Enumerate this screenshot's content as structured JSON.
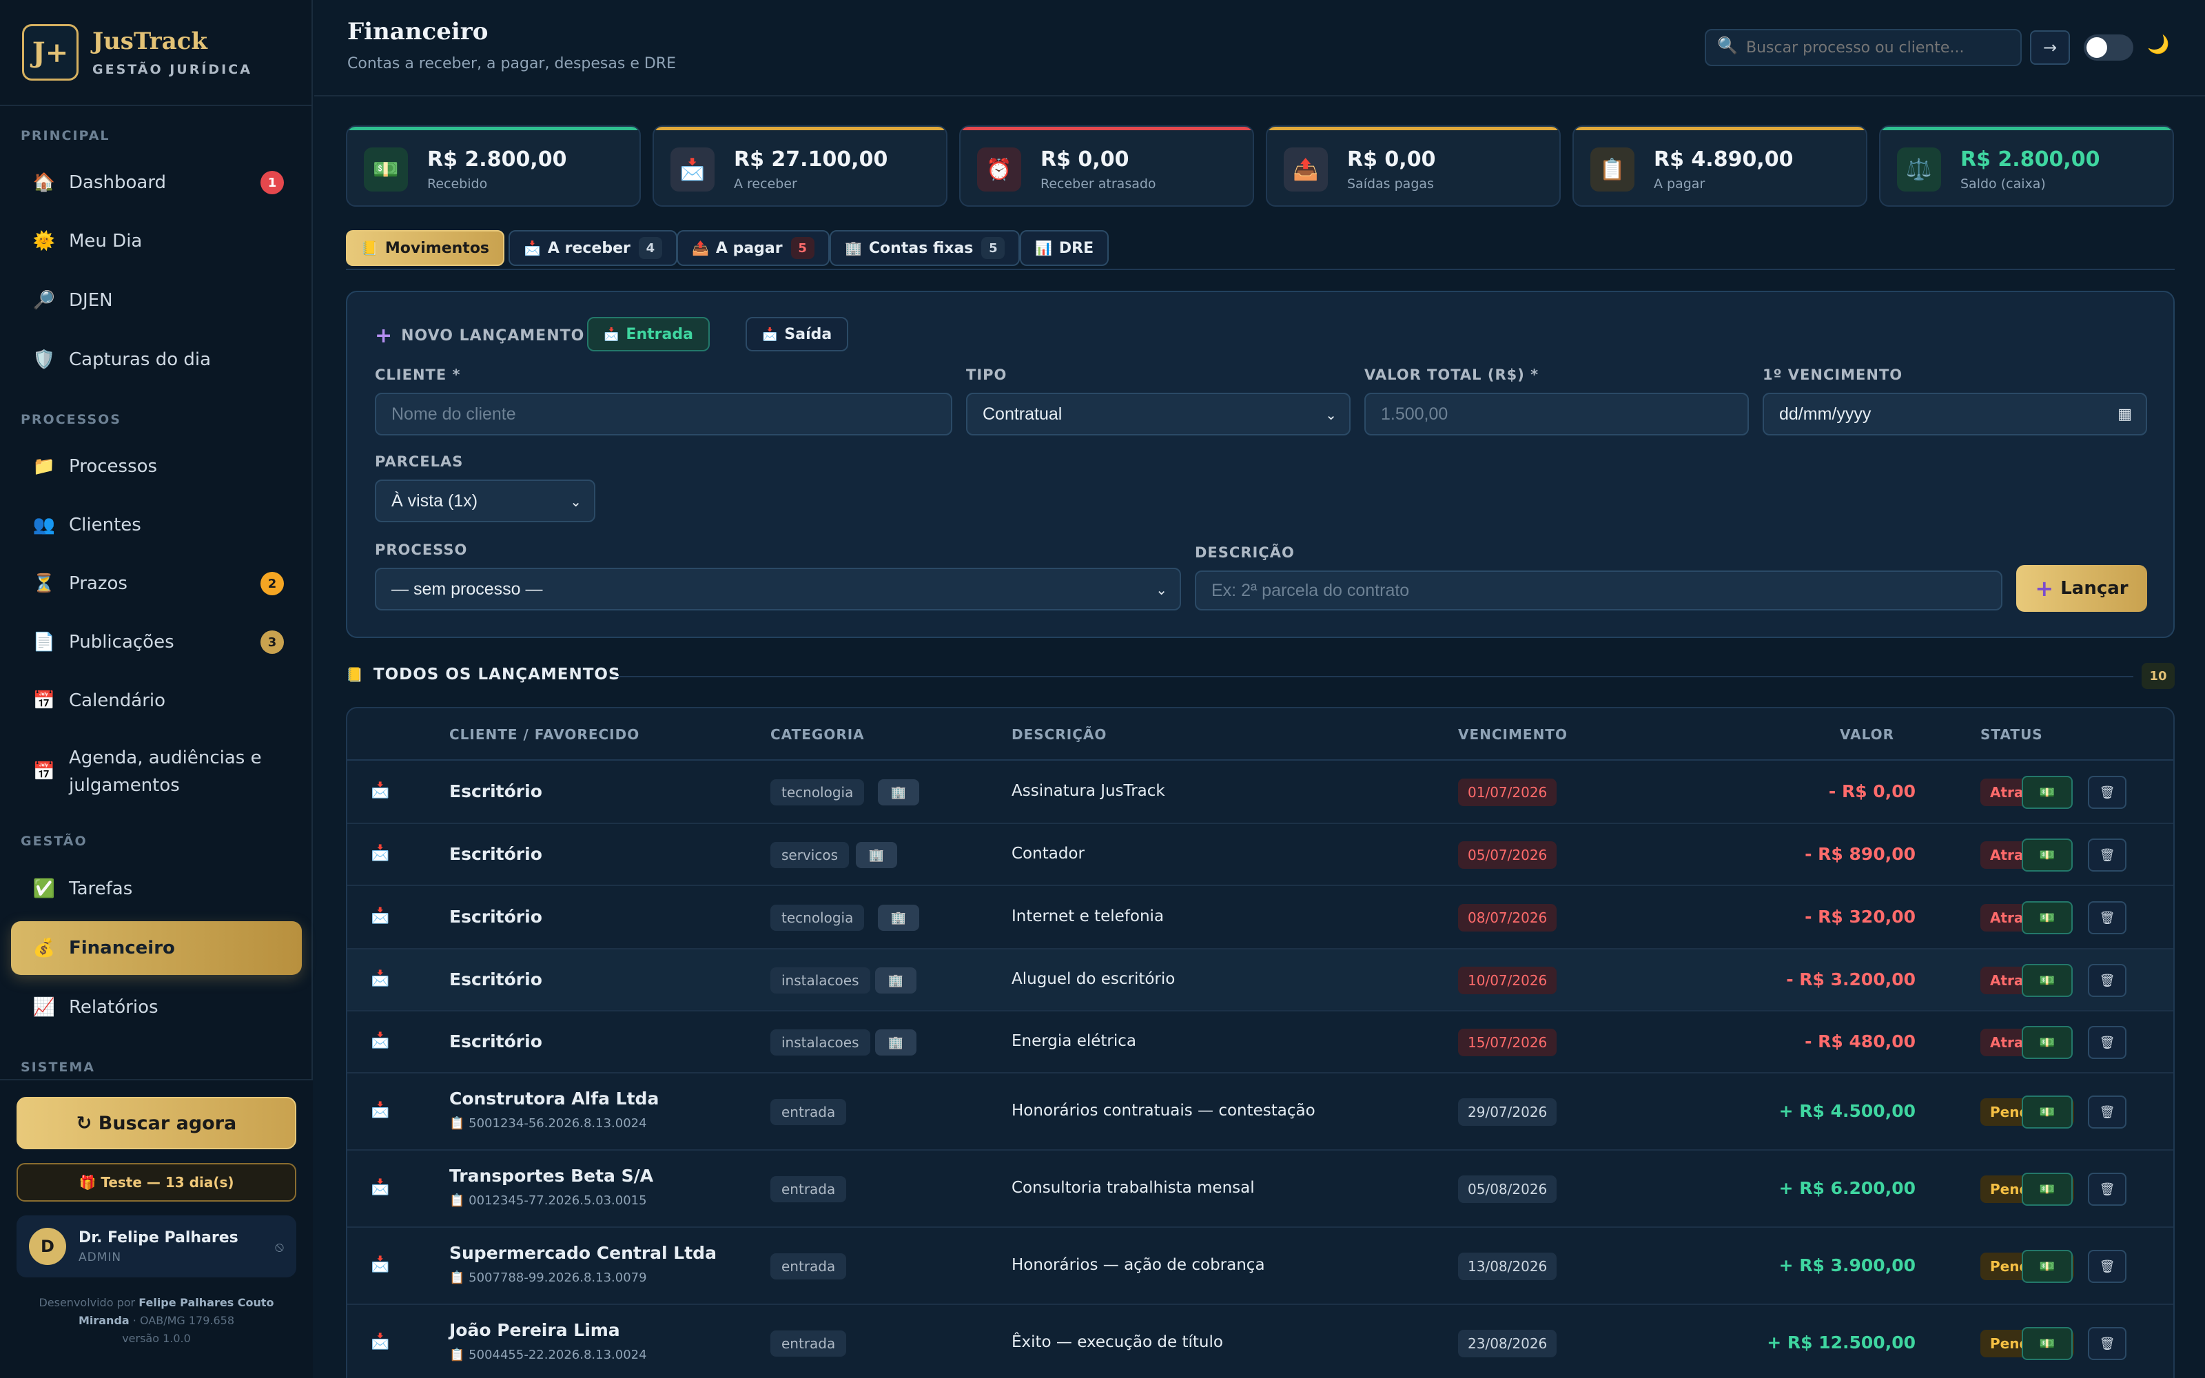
{
  "brand": {
    "logo": "J+",
    "name": "JusTrack",
    "subtitle": "GESTÃO JURÍDICA"
  },
  "sidebar": {
    "sections": {
      "principal": "PRINCIPAL",
      "processos": "PROCESSOS",
      "gestao": "GESTÃO",
      "sistema": "SISTEMA"
    },
    "items": [
      {
        "label": "Dashboard",
        "icon": "🏠",
        "badge": "1"
      },
      {
        "label": "Meu Dia",
        "icon": "🌞"
      },
      {
        "label": "DJEN",
        "icon": "🔎"
      },
      {
        "label": "Capturas do dia",
        "icon": "🛡️"
      },
      {
        "label": "Processos",
        "icon": "📁"
      },
      {
        "label": "Clientes",
        "icon": "👥"
      },
      {
        "label": "Prazos",
        "icon": "⏳",
        "badge": "2"
      },
      {
        "label": "Publicações",
        "icon": "📄",
        "badge": "3"
      },
      {
        "label": "Calendário",
        "icon": "📅"
      },
      {
        "label": "Agenda, audiências e julgamentos",
        "icon": "📅"
      },
      {
        "label": "Tarefas",
        "icon": "✅"
      },
      {
        "label": "Financeiro",
        "icon": "💰"
      },
      {
        "label": "Relatórios",
        "icon": "📈"
      }
    ],
    "search_now": "↻ Buscar agora",
    "trial": "🎁 Teste — 13 dia(s)",
    "user": {
      "initial": "D",
      "name": "Dr. Felipe Palhares",
      "role": "ADMIN",
      "action_icon": "⦸"
    },
    "dev_prefix": "Desenvolvido por",
    "dev_name": "Felipe Palhares Couto Miranda",
    "dev_suffix": "· OAB/MG 179.658",
    "version": "versão 1.0.0"
  },
  "header": {
    "title": "Financeiro",
    "subtitle": "Contas a receber, a pagar, despesas e DRE",
    "search_placeholder": "Buscar processo ou cliente...",
    "search_icon": "🔍",
    "go_label": "→",
    "moon_icon": "🌙"
  },
  "stats": [
    {
      "value": "R$ 2.800,00",
      "label": "Recebido",
      "icon": "💵",
      "color": "#2fbf8f"
    },
    {
      "value": "R$ 27.100,00",
      "label": "A receber",
      "icon": "📩",
      "color": "#e0a93a"
    },
    {
      "value": "R$ 0,00",
      "label": "Receber atrasado",
      "icon": "⏰",
      "color": "#e5484d"
    },
    {
      "value": "R$ 0,00",
      "label": "Saídas pagas",
      "icon": "📤",
      "color": "#e0a93a"
    },
    {
      "value": "R$ 4.890,00",
      "label": "A pagar",
      "icon": "📋",
      "color": "#e0a93a"
    },
    {
      "value": "R$ 2.800,00",
      "label": "Saldo (caixa)",
      "icon": "⚖️",
      "color": "#2fbf8f"
    }
  ],
  "tabs": [
    {
      "label": "Movimentos",
      "icon": "📒"
    },
    {
      "label": "A receber",
      "icon": "📩",
      "count": "4"
    },
    {
      "label": "A pagar",
      "icon": "📤",
      "count": "5"
    },
    {
      "label": "Contas fixas",
      "icon": "🏢",
      "count": "5"
    },
    {
      "label": "DRE",
      "icon": "📊"
    }
  ],
  "form": {
    "heading": "NOVO LANÇAMENTO",
    "entrada": "Entrada",
    "saida": "Saída",
    "cliente_label": "CLIENTE *",
    "cliente_placeholder": "Nome do cliente",
    "tipo_label": "TIPO",
    "tipo_value": "Contratual",
    "valor_label": "VALOR TOTAL (R$) *",
    "valor_placeholder": "1.500,00",
    "venc_label": "1º VENCIMENTO",
    "venc_placeholder": "dd/mm/yyyy",
    "parcelas_label": "PARCELAS",
    "parcelas_value": "À vista (1x)",
    "processo_label": "PROCESSO",
    "processo_value": "— sem processo —",
    "descricao_label": "DESCRIÇÃO",
    "descricao_placeholder": "Ex: 2ª parcela do contrato",
    "submit": "Lançar"
  },
  "list": {
    "title": "TODOS OS LANÇAMENTOS",
    "count": "10",
    "columns": {
      "cliente": "CLIENTE / FAVORECIDO",
      "categoria": "CATEGORIA",
      "descricao": "DESCRIÇÃO",
      "vencimento": "VENCIMENTO",
      "valor": "VALOR",
      "status": "STATUS"
    },
    "rows": [
      {
        "client": "Escritório",
        "category": "tecnologia",
        "fixed": true,
        "description": "Assinatura JusTrack",
        "due": "01/07/2026",
        "amount": "- R$ 0,00",
        "status": "Atrasado",
        "late": true
      },
      {
        "client": "Escritório",
        "category": "servicos",
        "fixed": true,
        "description": "Contador",
        "due": "05/07/2026",
        "amount": "- R$ 890,00",
        "status": "Atrasado",
        "late": true
      },
      {
        "client": "Escritório",
        "category": "tecnologia",
        "fixed": true,
        "description": "Internet e telefonia",
        "due": "08/07/2026",
        "amount": "- R$ 320,00",
        "status": "Atrasado",
        "late": true
      },
      {
        "client": "Escritório",
        "category": "instalacoes",
        "fixed": true,
        "description": "Aluguel do escritório",
        "due": "10/07/2026",
        "amount": "- R$ 3.200,00",
        "status": "Atrasado",
        "late": true
      },
      {
        "client": "Escritório",
        "category": "instalacoes",
        "fixed": true,
        "description": "Energia elétrica",
        "due": "15/07/2026",
        "amount": "- R$ 480,00",
        "status": "Atrasado",
        "late": true
      },
      {
        "client": "Construtora Alfa Ltda",
        "process": "5001234-56.2026.8.13.0024",
        "category": "entrada",
        "description": "Honorários contratuais — contestação",
        "due": "29/07/2026",
        "amount": "+ R$ 4.500,00",
        "status": "Pendente"
      },
      {
        "client": "Transportes Beta S/A",
        "process": "0012345-77.2026.5.03.0015",
        "category": "entrada",
        "description": "Consultoria trabalhista mensal",
        "due": "05/08/2026",
        "amount": "+ R$ 6.200,00",
        "status": "Pendente"
      },
      {
        "client": "Supermercado Central Ltda",
        "process": "5007788-99.2026.8.13.0079",
        "category": "entrada",
        "description": "Honorários — ação de cobrança",
        "due": "13/08/2026",
        "amount": "+ R$ 3.900,00",
        "status": "Pendente"
      },
      {
        "client": "João Pereira Lima",
        "process": "5004455-22.2026.8.13.0024",
        "category": "entrada",
        "description": "Êxito — execução de título",
        "due": "23/08/2026",
        "amount": "+ R$ 12.500,00",
        "status": "Pendente"
      }
    ],
    "row_icon": "📩",
    "fixed_icon": "🏢",
    "process_icon": "📋",
    "pay_icon": "💵",
    "delete_icon": "🗑"
  }
}
